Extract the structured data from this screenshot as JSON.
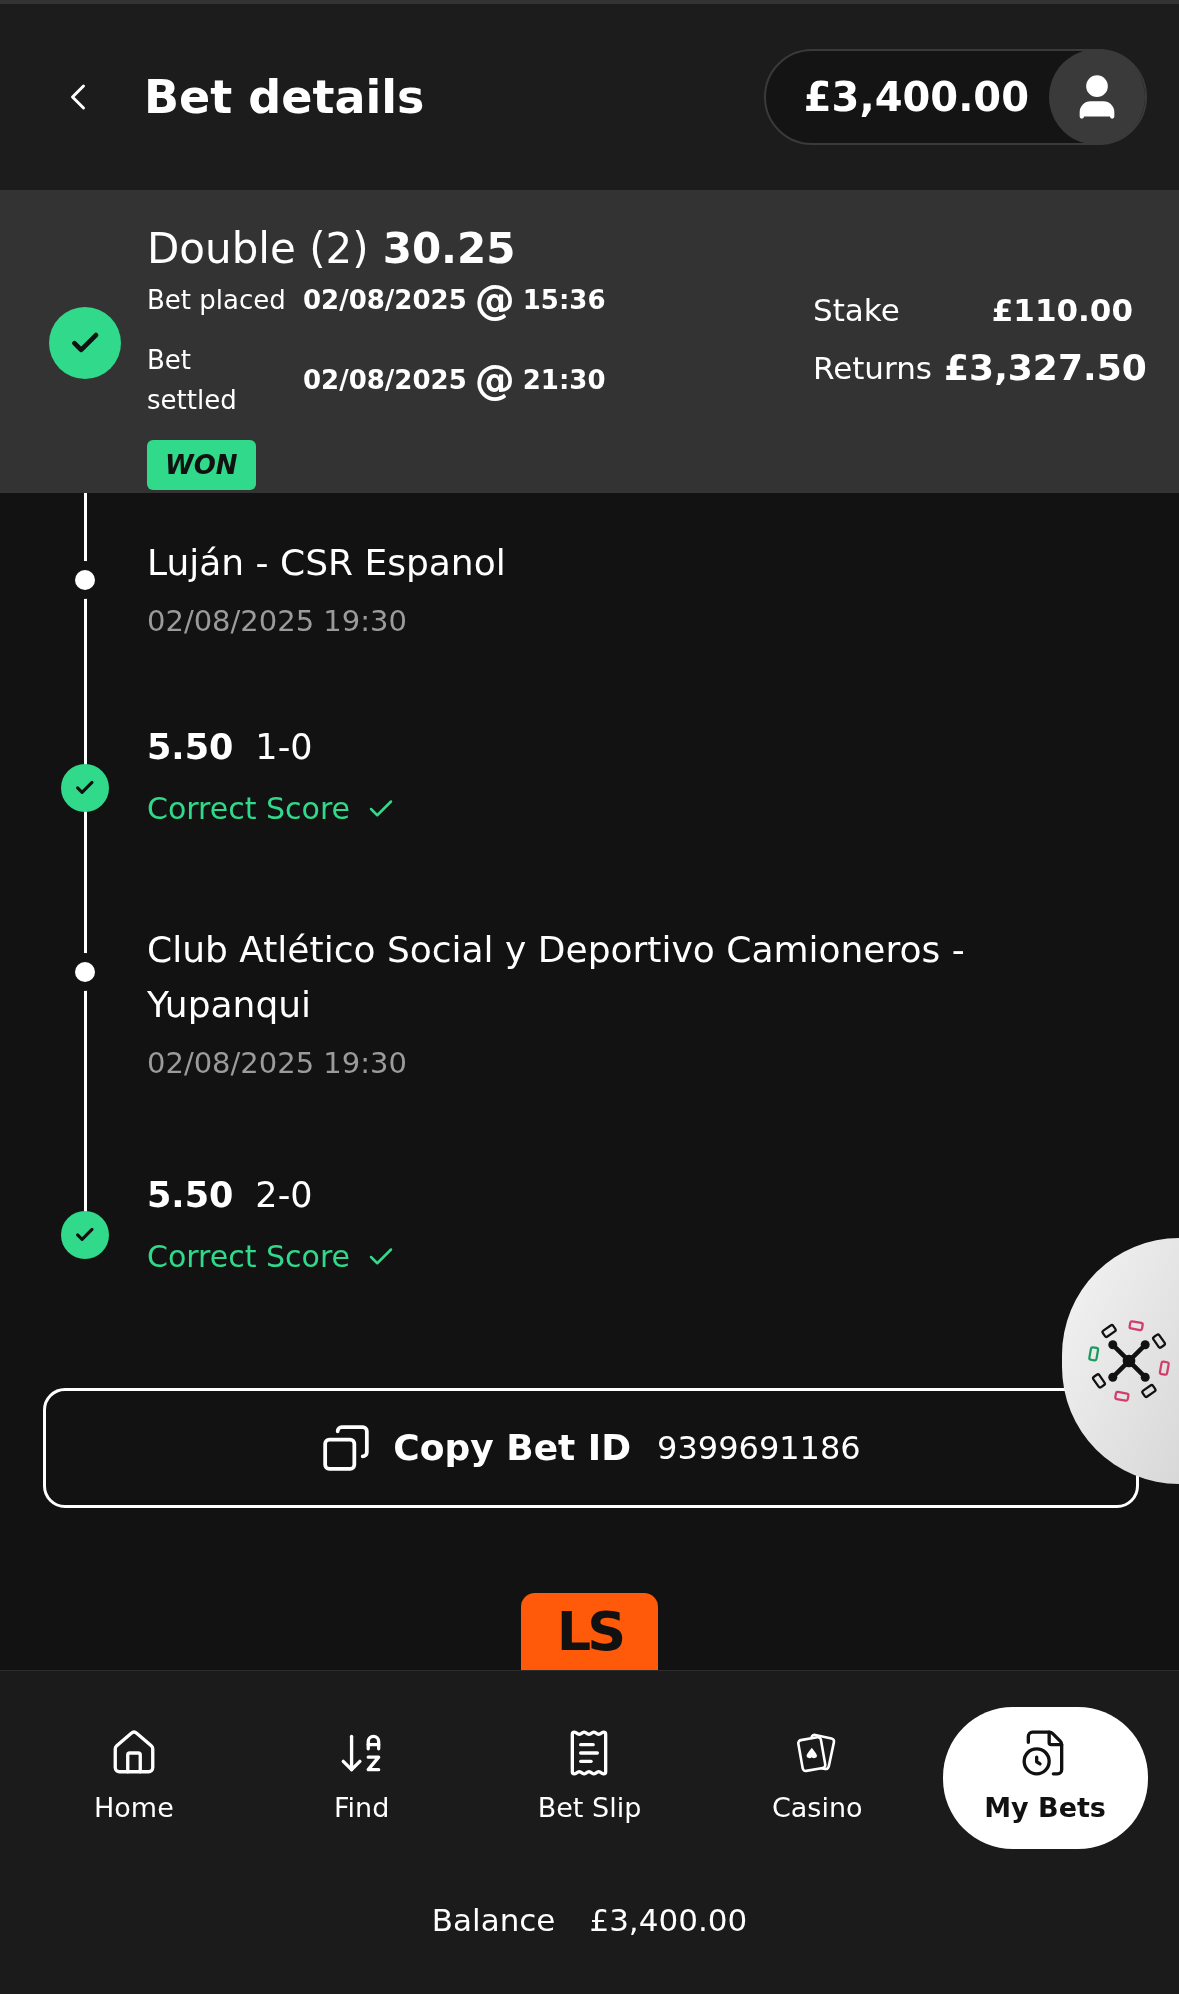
{
  "header": {
    "title": "Bet details",
    "balance": "£3,400.00"
  },
  "bet": {
    "type": "Double (2)",
    "odds": "30.25",
    "won": true,
    "times": [
      {
        "label": "Bet placed",
        "date": "02/08/2025",
        "separator": "@",
        "time": "15:36"
      },
      {
        "label": "Bet settled",
        "date": "02/08/2025",
        "separator": "@",
        "time": "21:30"
      }
    ],
    "stake_label": "Stake",
    "stake": "£110.00",
    "returns_label": "Returns",
    "returns": "£3,327.50",
    "status": "WON"
  },
  "legs": [
    {
      "event": "Luján - CSR Espanol",
      "datetime": "02/08/2025 19:30",
      "odds": "5.50",
      "selection": "1-0",
      "market": "Correct Score",
      "won": true
    },
    {
      "event": "Club Atlético Social y Deportivo Camioneros - Yupanqui",
      "datetime": "02/08/2025 19:30",
      "odds": "5.50",
      "selection": "2-0",
      "market": "Correct Score",
      "won": true
    }
  ],
  "copy_button": {
    "label": "Copy Bet ID",
    "bet_id": "9399691186"
  },
  "logo": "LS",
  "nav": [
    {
      "label": "Home",
      "selected": false
    },
    {
      "label": "Find",
      "selected": false
    },
    {
      "label": "Bet Slip",
      "selected": false
    },
    {
      "label": "Casino",
      "selected": false
    },
    {
      "label": "My Bets",
      "selected": true
    }
  ],
  "footer": {
    "label": "Balance",
    "amount": "£3,400.00"
  }
}
